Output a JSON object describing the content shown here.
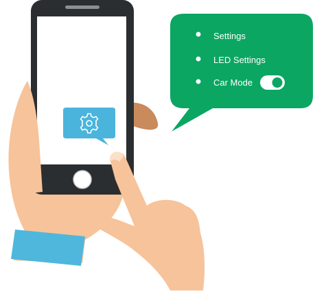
{
  "bubble": {
    "items": [
      {
        "label": "Settings"
      },
      {
        "label": "LED Settings"
      },
      {
        "label": "Car Mode",
        "toggle_on": true
      }
    ],
    "background_color": "#0aa662"
  },
  "phone": {
    "settings_button_icon": "gear-icon",
    "settings_button_color": "#4bb4dc",
    "body_color": "#2b2e30"
  },
  "illustration": {
    "skin_color": "#f7c39a",
    "sleeve_color": "#4fb7dc"
  }
}
